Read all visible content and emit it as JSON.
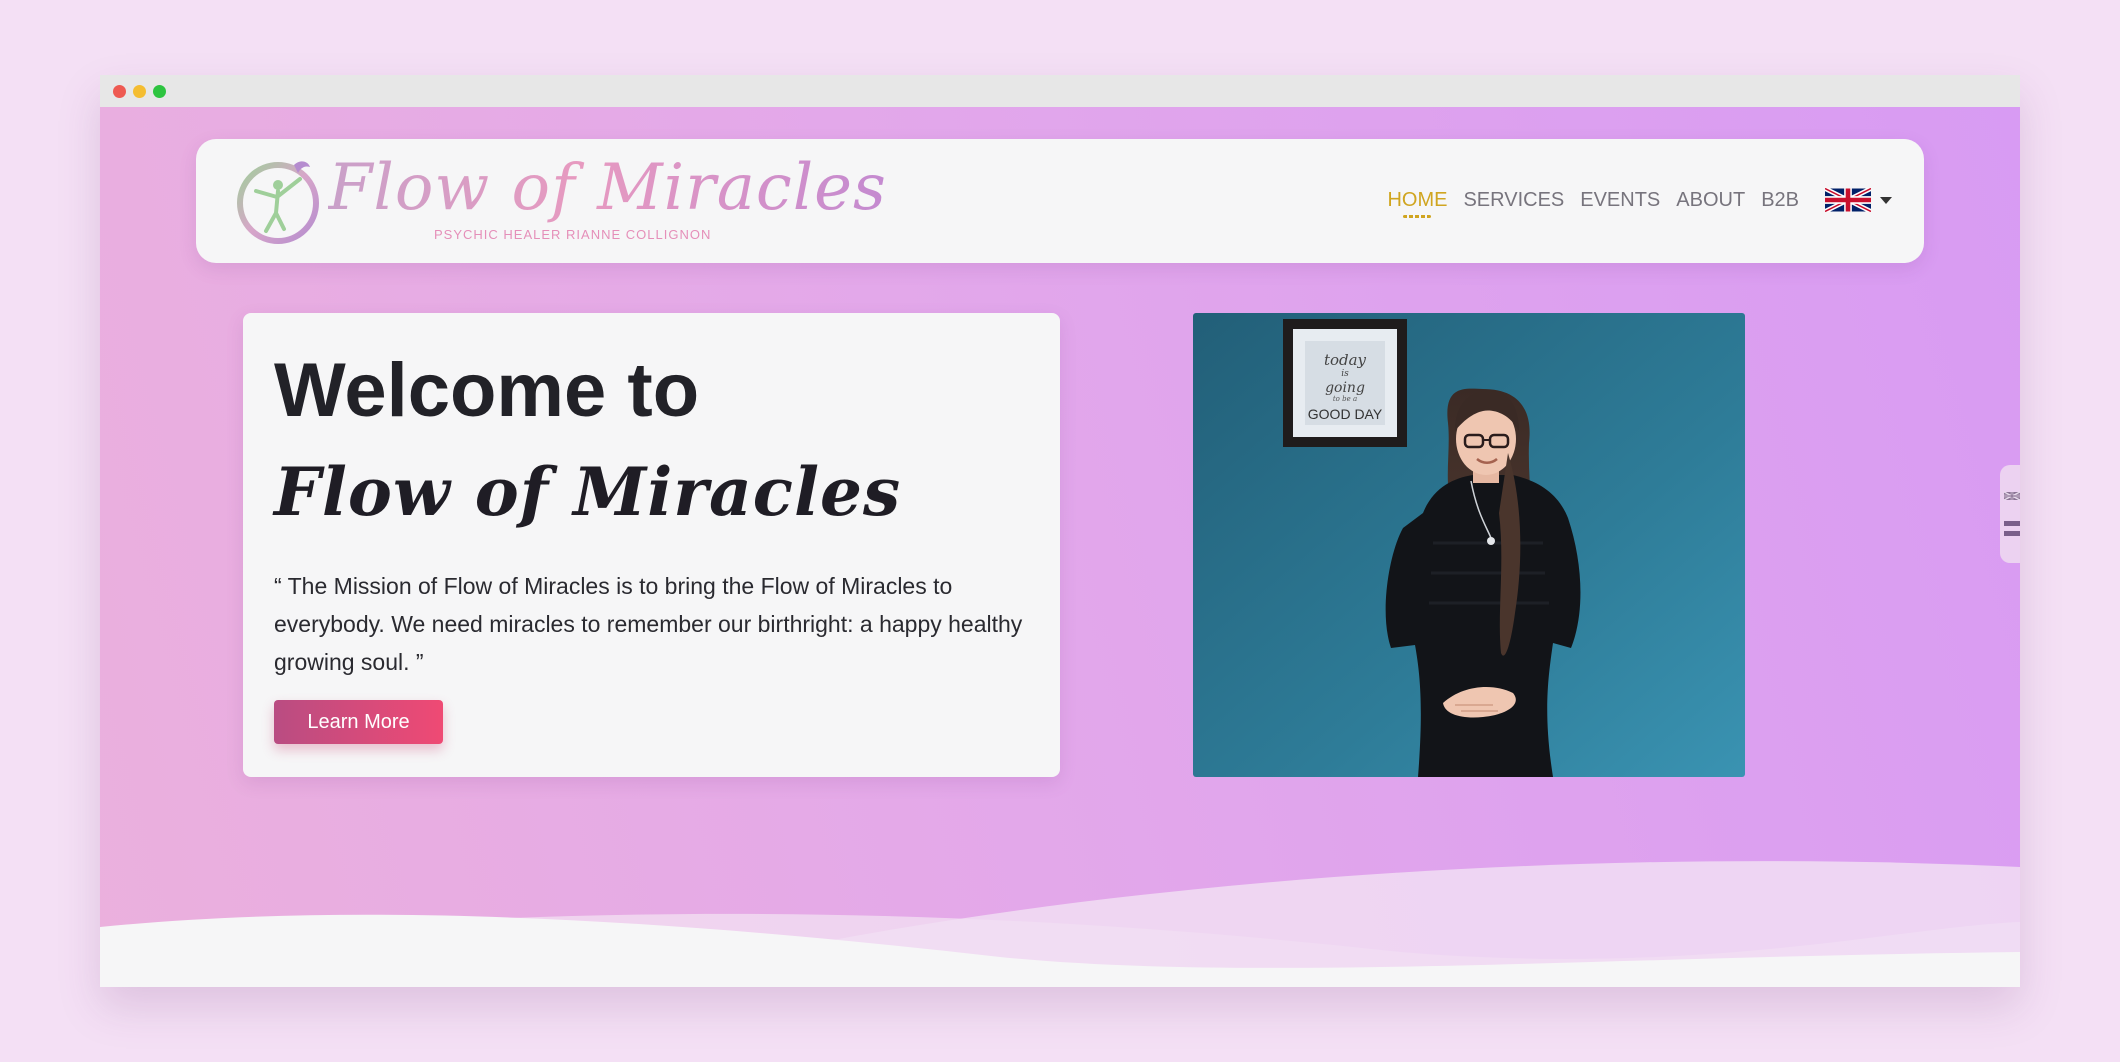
{
  "window": {
    "controls": [
      "close",
      "minimize",
      "maximize"
    ]
  },
  "brand": {
    "name": "Flow of Miracles",
    "tagline": "PSYCHIC HEALER RIANNE COLLIGNON",
    "emblem_icon": "dancer-circle-icon"
  },
  "nav": {
    "items": [
      {
        "label": "HOME",
        "active": true
      },
      {
        "label": "SERVICES",
        "active": false
      },
      {
        "label": "EVENTS",
        "active": false
      },
      {
        "label": "ABOUT",
        "active": false
      },
      {
        "label": "B2B",
        "active": false
      }
    ],
    "language_icon": "uk-flag-icon"
  },
  "hero": {
    "heading": "Welcome to",
    "brand_script": "Flow of Miracles",
    "mission": "“ The Mission of Flow of Miracles is to bring the Flow of Miracles to everybody. We need miracles to remember our birthright: a happy healthy growing soul. ”",
    "cta_label": "Learn More",
    "frame_text": [
      "today",
      "is",
      "going",
      "to be a",
      "GOOD DAY"
    ]
  },
  "side_widget": {
    "icons": [
      "uk-flag-icon",
      "menu-icon"
    ]
  },
  "colors": {
    "accent_active": "#d0a520",
    "button_start": "#b94c82",
    "button_end": "#ef4a74",
    "hero_gradient_start": "#ebb0dd",
    "hero_gradient_end": "#d89bf3",
    "wall_teal": "#2e7c98"
  }
}
